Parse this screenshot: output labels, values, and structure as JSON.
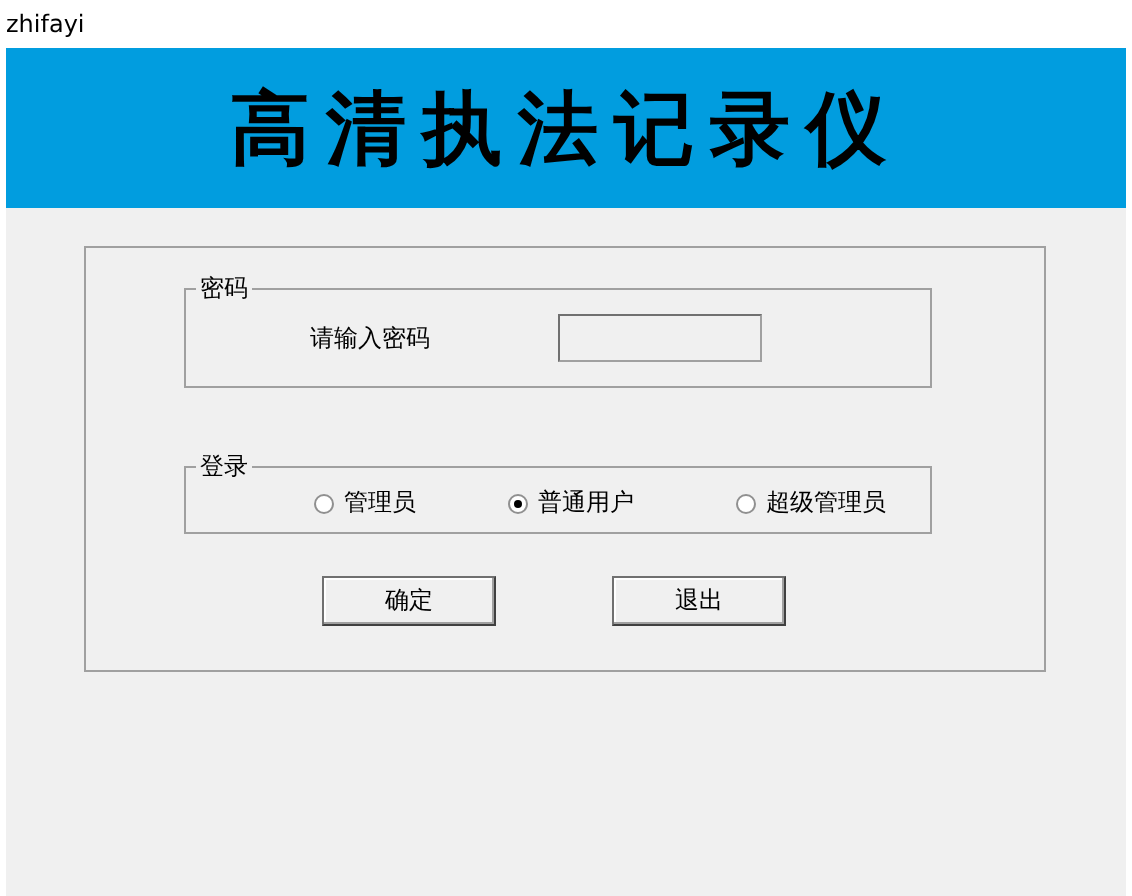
{
  "window": {
    "title": "zhifayi"
  },
  "banner": {
    "title": "高清执法记录仪"
  },
  "password_group": {
    "legend": "密码",
    "label": "请输入密码"
  },
  "login_group": {
    "legend": "登录",
    "options": [
      {
        "label": "管理员",
        "selected": false
      },
      {
        "label": "普通用户",
        "selected": true
      },
      {
        "label": "超级管理员",
        "selected": false
      }
    ]
  },
  "buttons": [
    {
      "label": "确定"
    },
    {
      "label": "退出"
    }
  ]
}
